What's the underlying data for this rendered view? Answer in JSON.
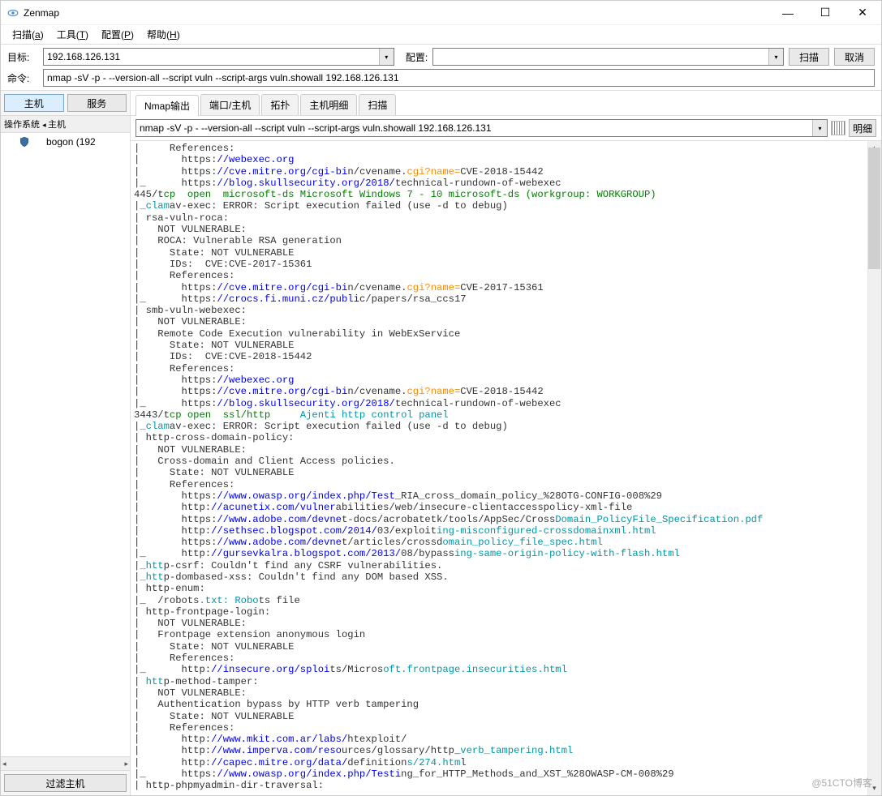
{
  "window": {
    "title": "Zenmap",
    "min": "—",
    "max": "☐",
    "close": "✕"
  },
  "menu": [
    {
      "label": "扫描",
      "key": "a"
    },
    {
      "label": "工具",
      "key": "T"
    },
    {
      "label": "配置",
      "key": "P"
    },
    {
      "label": "帮助",
      "key": "H"
    }
  ],
  "labels": {
    "target": "目标:",
    "profile": "配置:",
    "cmd": "命令:"
  },
  "target": {
    "value": "192.168.126.131"
  },
  "profile": {
    "value": ""
  },
  "command": {
    "value": "nmap -sV -p - --version-all --script vuln --script-args vuln.showall 192.168.126.131"
  },
  "buttons": {
    "scan": "扫描",
    "cancel": "取消",
    "hosts": "主机",
    "services": "服务",
    "filter": "过滤主机",
    "detail": "明细"
  },
  "left": {
    "col_os": "操作系统",
    "col_host": "主机",
    "sort_arrow": "◂",
    "hosts": [
      {
        "name": "bogon (192"
      }
    ]
  },
  "rtabs": [
    "Nmap输出",
    "端口/主机",
    "拓扑",
    "主机明细",
    "扫描"
  ],
  "cmdFilter": {
    "value": "nmap -sV -p - --version-all --script vuln --script-args vuln.showall 192.168.126.131"
  },
  "watermark": "@51CTO博客",
  "output": {
    "lines": [
      [
        {
          "t": "|     References:"
        }
      ],
      [
        {
          "t": "|       https:"
        },
        {
          "t": "//webexec.org",
          "c": "blue"
        }
      ],
      [
        {
          "t": "|       https:"
        },
        {
          "t": "//cve.mitre.org/cgi-bi",
          "c": "blue"
        },
        {
          "t": "n/cvename."
        },
        {
          "t": "cgi?name=",
          "c": "orange"
        },
        {
          "t": "CVE-2018-15442"
        }
      ],
      [
        {
          "t": "|_      https:"
        },
        {
          "t": "//blog.skullsecurity.org/2018/",
          "c": "blue"
        },
        {
          "t": "technical-rundown-of-webexec"
        }
      ],
      [
        {
          "t": "445/t"
        },
        {
          "t": "cp  open  microsoft-ds Microsoft Windows 7 - 10 microsoft-ds (workgroup: WORKGROUP)",
          "c": "green"
        }
      ],
      [
        {
          "t": "|"
        },
        {
          "t": "_clam",
          "c": "teal"
        },
        {
          "t": "av-exec: ERROR: Script execution failed (use -d to debug)"
        }
      ],
      [
        {
          "t": "| rsa-vuln-roca:"
        }
      ],
      [
        {
          "t": "|   NOT VULNERABLE:"
        }
      ],
      [
        {
          "t": "|   ROCA: Vulnerable RSA generation"
        }
      ],
      [
        {
          "t": "|     State: NOT VULNERABLE"
        }
      ],
      [
        {
          "t": "|     IDs:  CVE:CVE-2017-15361"
        }
      ],
      [
        {
          "t": "|     References:"
        }
      ],
      [
        {
          "t": "|       https:"
        },
        {
          "t": "//cve.mitre.org/cgi-bi",
          "c": "blue"
        },
        {
          "t": "n/cvename."
        },
        {
          "t": "cgi?name=",
          "c": "orange"
        },
        {
          "t": "CVE-2017-15361"
        }
      ],
      [
        {
          "t": "|_      https:"
        },
        {
          "t": "//crocs.fi.muni.cz/publi",
          "c": "blue"
        },
        {
          "t": "c/papers/rsa_ccs17"
        }
      ],
      [
        {
          "t": "| smb-vuln-webexec:"
        }
      ],
      [
        {
          "t": "|   NOT VULNERABLE:"
        }
      ],
      [
        {
          "t": "|   Remote Code Execution vulnerability in WebExService"
        }
      ],
      [
        {
          "t": "|     State: NOT VULNERABLE"
        }
      ],
      [
        {
          "t": "|     IDs:  CVE:CVE-2018-15442"
        }
      ],
      [
        {
          "t": "|     References:"
        }
      ],
      [
        {
          "t": "|       https:"
        },
        {
          "t": "//webexec.org",
          "c": "blue"
        }
      ],
      [
        {
          "t": "|       https:"
        },
        {
          "t": "//cve.mitre.org/cgi-bi",
          "c": "blue"
        },
        {
          "t": "n/cvename."
        },
        {
          "t": "cgi?name=",
          "c": "orange"
        },
        {
          "t": "CVE-2018-15442"
        }
      ],
      [
        {
          "t": "|_      https:"
        },
        {
          "t": "//blog.skullsecurity.org/2018/",
          "c": "blue"
        },
        {
          "t": "technical-rundown-of-webexec"
        }
      ],
      [
        {
          "t": "3443/t"
        },
        {
          "t": "cp open  ssl/http     ",
          "c": "green"
        },
        {
          "t": "Ajenti http control panel",
          "c": "teal"
        }
      ],
      [
        {
          "t": "|"
        },
        {
          "t": "_clam",
          "c": "teal"
        },
        {
          "t": "av-exec: ERROR: Script execution failed (use -d to debug)"
        }
      ],
      [
        {
          "t": "| http-cross-domain-policy:"
        }
      ],
      [
        {
          "t": "|   NOT VULNERABLE:"
        }
      ],
      [
        {
          "t": "|   Cross-domain and Client Access policies."
        }
      ],
      [
        {
          "t": "|     State: NOT VULNERABLE"
        }
      ],
      [
        {
          "t": "|     References:"
        }
      ],
      [
        {
          "t": "|       https:"
        },
        {
          "t": "//www.owasp.org/index.php/Test",
          "c": "blue"
        },
        {
          "t": "_RIA_cross_domain_policy_%28OTG-CONFIG-008%29"
        }
      ],
      [
        {
          "t": "|       http:"
        },
        {
          "t": "//acunetix.com/vulner",
          "c": "blue"
        },
        {
          "t": "abilities/web/insecure-clientaccesspolicy-xml-file"
        }
      ],
      [
        {
          "t": "|       https:"
        },
        {
          "t": "//www.adobe.com/devne",
          "c": "blue"
        },
        {
          "t": "t-docs/acrobatetk/tools/AppSec/Cross"
        },
        {
          "t": "Domain_PolicyFile_Specification.pdf",
          "c": "teal"
        }
      ],
      [
        {
          "t": "|       http:"
        },
        {
          "t": "//sethsec.blogspot.com/2014/",
          "c": "blue"
        },
        {
          "t": "03/exploit"
        },
        {
          "t": "ing-misconfigured-crossdomainxml.html",
          "c": "teal"
        }
      ],
      [
        {
          "t": "|       https:"
        },
        {
          "t": "//www.adobe.com/devne",
          "c": "blue"
        },
        {
          "t": "t/articles/crossd"
        },
        {
          "t": "omain_policy_file_spec.html",
          "c": "teal"
        }
      ],
      [
        {
          "t": "|_      http:"
        },
        {
          "t": "//gursevkalra.blogspot.com/2013/",
          "c": "blue"
        },
        {
          "t": "08/bypass"
        },
        {
          "t": "ing-same-origin-policy-with-flash.html",
          "c": "teal"
        }
      ],
      [
        {
          "t": "|"
        },
        {
          "t": "_htt",
          "c": "teal"
        },
        {
          "t": "p-csrf: Couldn't find any CSRF vulnerabilities."
        }
      ],
      [
        {
          "t": "|"
        },
        {
          "t": "_htt",
          "c": "teal"
        },
        {
          "t": "p-dombased-xss: Couldn't find any DOM based XSS."
        }
      ],
      [
        {
          "t": "| http-enum:"
        }
      ],
      [
        {
          "t": "|_  /robots"
        },
        {
          "t": ".txt: Robo",
          "c": "teal"
        },
        {
          "t": "ts file"
        }
      ],
      [
        {
          "t": "| http-frontpage-login:"
        }
      ],
      [
        {
          "t": "|   NOT VULNERABLE:"
        }
      ],
      [
        {
          "t": "|   Frontpage extension anonymous login"
        }
      ],
      [
        {
          "t": "|     State: NOT VULNERABLE"
        }
      ],
      [
        {
          "t": "|     References:"
        }
      ],
      [
        {
          "t": "|_      http:"
        },
        {
          "t": "//insecure.org/sploi",
          "c": "blue"
        },
        {
          "t": "ts/Micros"
        },
        {
          "t": "oft.frontpage.insecurities.html",
          "c": "teal"
        }
      ],
      [
        {
          "t": "| "
        },
        {
          "t": "htt",
          "c": "teal"
        },
        {
          "t": "p-method-tamper:"
        }
      ],
      [
        {
          "t": "|   NOT VULNERABLE:"
        }
      ],
      [
        {
          "t": "|   Authentication bypass by HTTP verb tampering"
        }
      ],
      [
        {
          "t": "|     State: NOT VULNERABLE"
        }
      ],
      [
        {
          "t": "|     References:"
        }
      ],
      [
        {
          "t": "|       http:"
        },
        {
          "t": "//www.mkit.com.ar/labs/",
          "c": "blue"
        },
        {
          "t": "htexploit/"
        }
      ],
      [
        {
          "t": "|       http:"
        },
        {
          "t": "//www.imperva.com/reso",
          "c": "blue"
        },
        {
          "t": "urces/glossary/http_"
        },
        {
          "t": "verb_tampering.html",
          "c": "teal"
        }
      ],
      [
        {
          "t": "|       http:"
        },
        {
          "t": "//capec.mitre.org/data/",
          "c": "blue"
        },
        {
          "t": "definition"
        },
        {
          "t": "s/274.htm",
          "c": "teal"
        },
        {
          "t": "l"
        }
      ],
      [
        {
          "t": "|_      https:"
        },
        {
          "t": "//www.owasp.org/index.php/Testi",
          "c": "blue"
        },
        {
          "t": "ng_for_HTTP_Methods_and_XST_%28OWASP-CM-008%29"
        }
      ],
      [
        {
          "t": "| http-phpmyadmin-dir-traversal:"
        }
      ]
    ]
  }
}
